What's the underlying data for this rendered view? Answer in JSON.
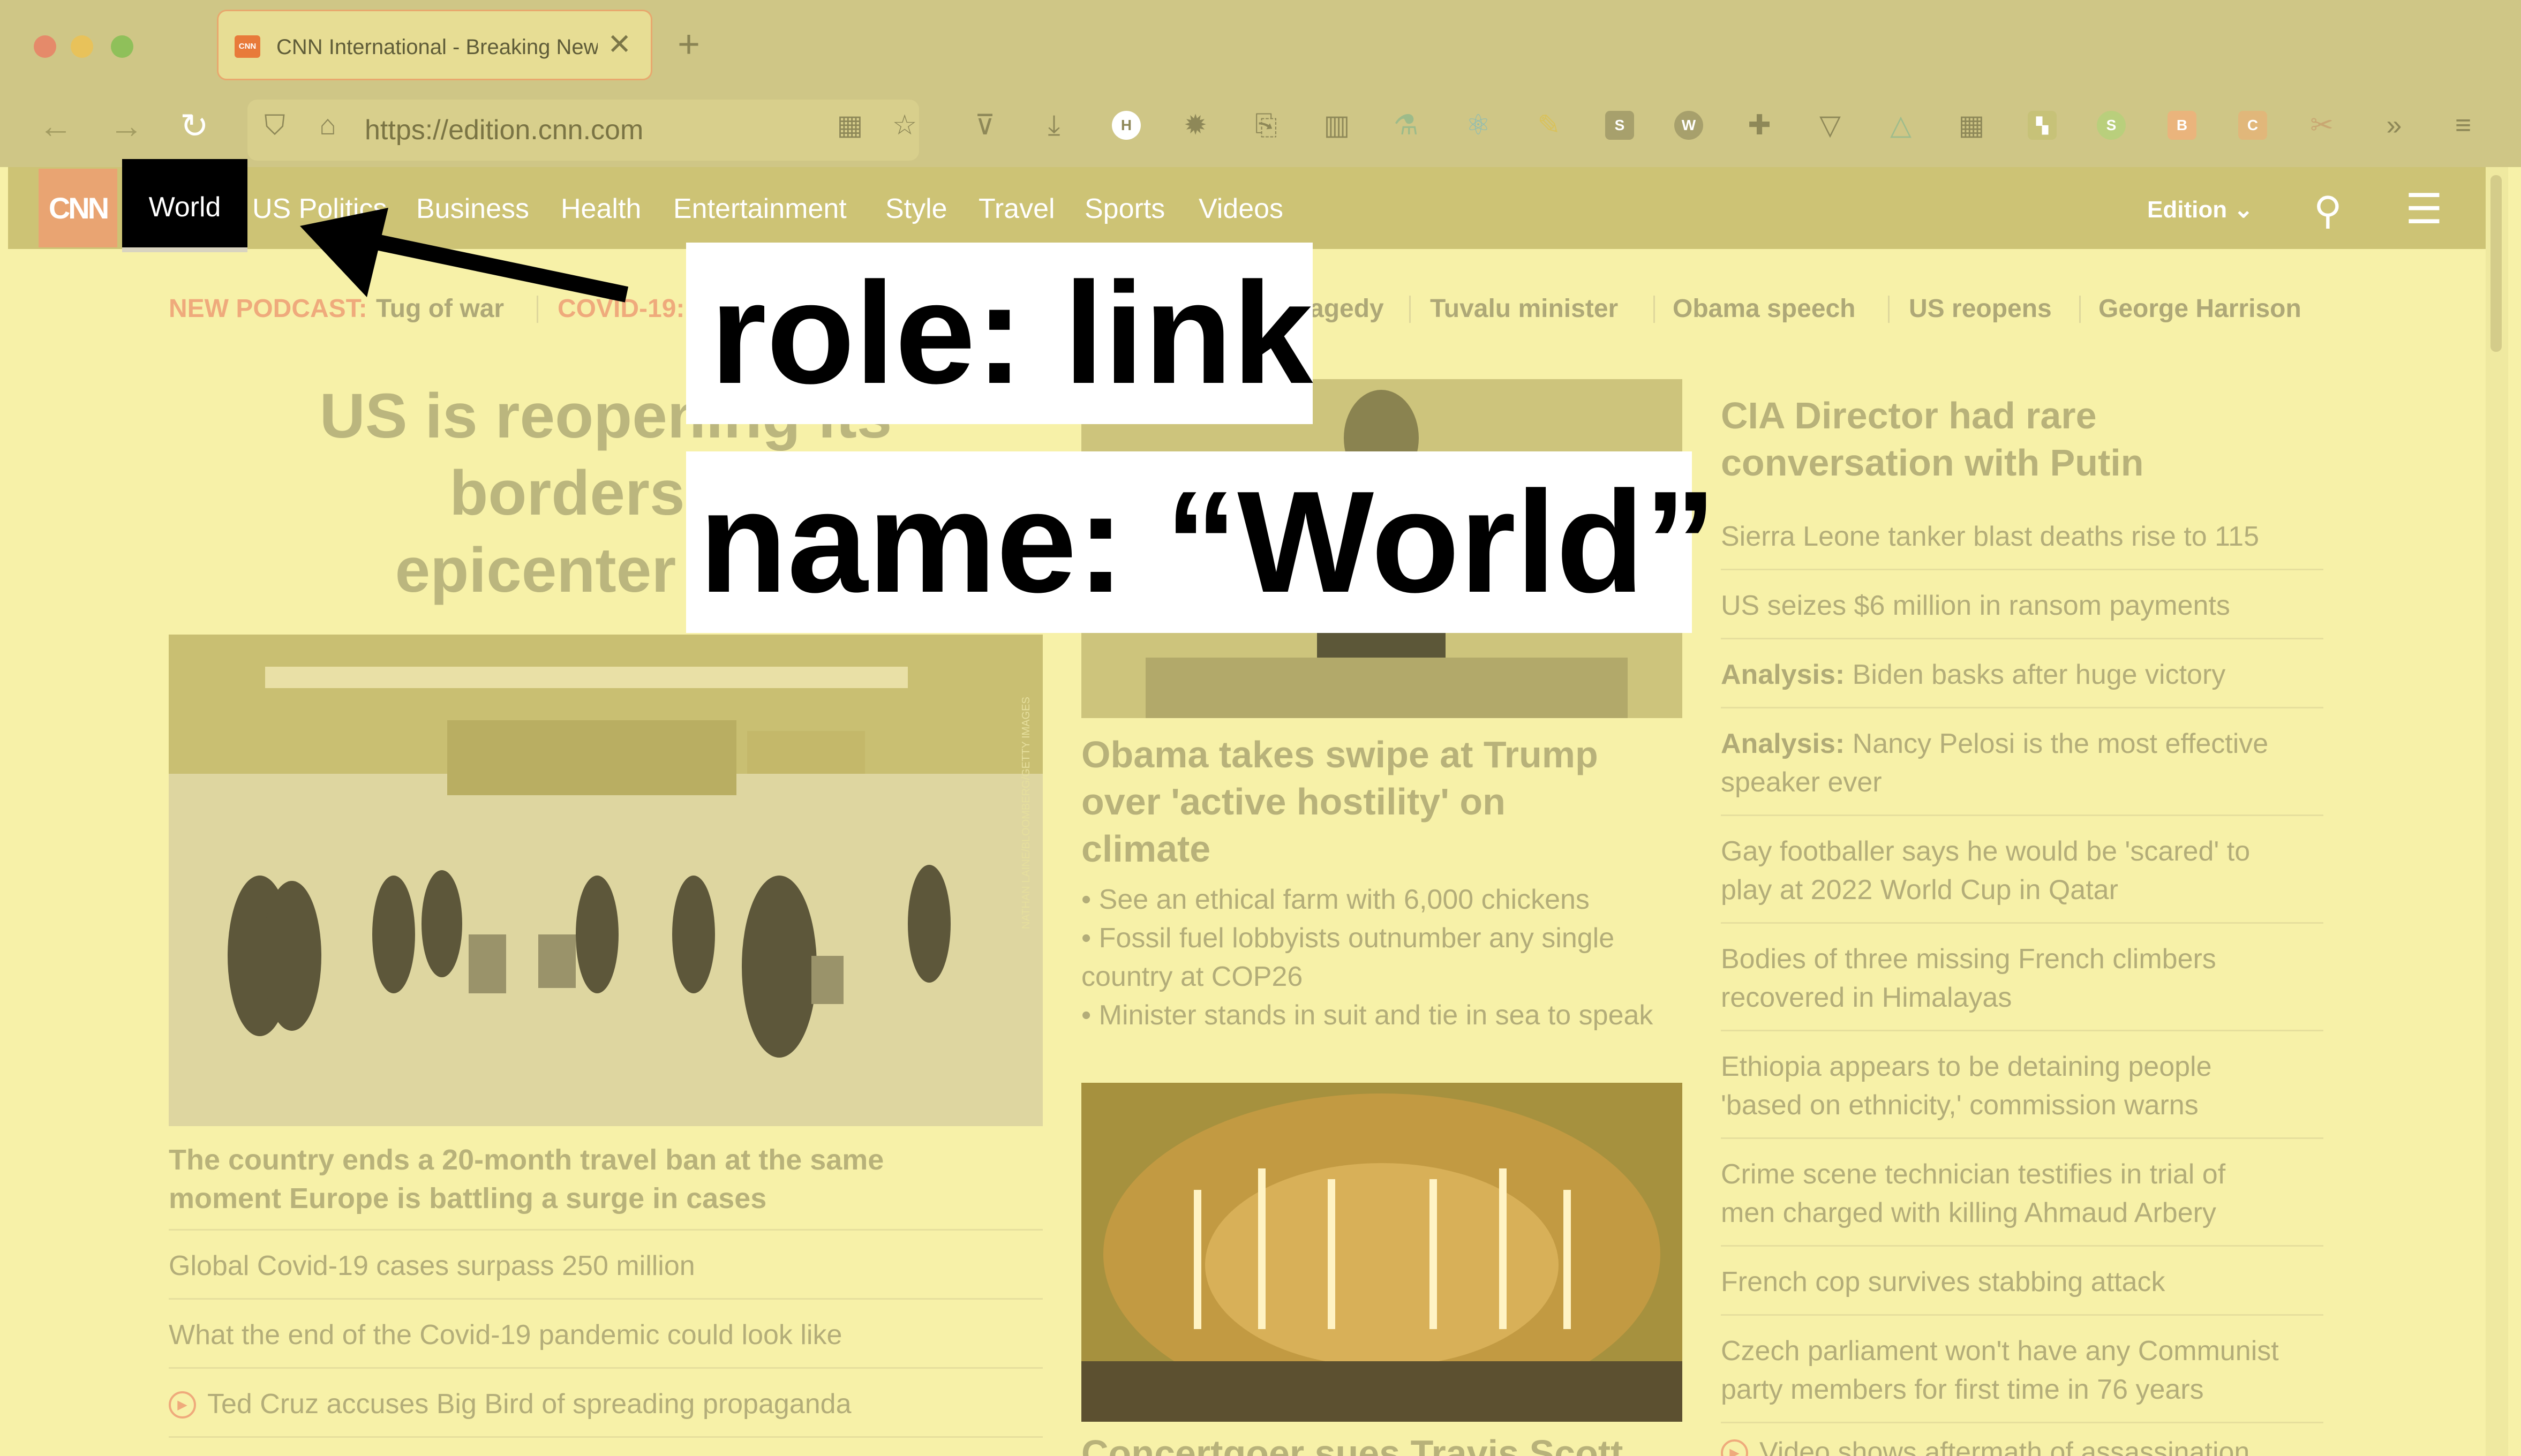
{
  "browser": {
    "tab_title": "CNN International - Breaking News",
    "tab_favicon": "CNN",
    "new_tab": "+",
    "close_tab": "✕",
    "url": "https://edition.cnn.com"
  },
  "nav": {
    "logo": "CNN",
    "active": "World",
    "links": [
      "US Politics",
      "Business",
      "Health",
      "Entertainment",
      "Style",
      "Travel",
      "Sports",
      "Videos"
    ],
    "edition": "Edition"
  },
  "trending": {
    "podcast_label": "NEW PODCAST:",
    "podcast_text": "Tug of war",
    "covid": "COVID-19:",
    "tragedy": "agedy",
    "items": [
      "Tuvalu minister",
      "Obama speech",
      "US reopens",
      "George Harrison"
    ]
  },
  "main": {
    "headline": "US is reopening its borders to epicenter of C",
    "headline_lines": [
      "US is reopening its",
      "borders to",
      "epicenter of C"
    ],
    "caption": "The country ends a 20-month travel ban at the same moment Europe is battling a surge in cases",
    "caption_lines": [
      "The country ends a 20-month travel ban at the same",
      "moment Europe is battling a surge in cases"
    ],
    "links": [
      "Global Covid-19 cases surpass 250 million",
      "What the end of the Covid-19 pandemic could look like",
      "Ted Cruz accuses Big Bird of spreading propaganda"
    ],
    "photo_credit": "NATHAN LAINE/BLOOMBERG/GETTY IMAGES"
  },
  "middle": {
    "headline_lines": [
      "Obama takes swipe at Trump",
      "over 'active hostility' on",
      "climate"
    ],
    "bullets": [
      "See an ethical farm with 6,000 chickens",
      "Fossil fuel lobbyists outnumber any single",
      "country at COP26",
      "Minister stands in suit and tie in sea to speak"
    ],
    "bottom_headline": "Concertgoer sues Travis Scott"
  },
  "right": {
    "headline_lines": [
      "CIA Director had rare",
      "conversation with Putin"
    ],
    "items": [
      {
        "prefix": "",
        "lines": [
          "Sierra Leone tanker blast deaths rise to 115"
        ]
      },
      {
        "prefix": "",
        "lines": [
          "US seizes $6 million in ransom payments"
        ]
      },
      {
        "prefix": "Analysis:",
        "lines": [
          " Biden basks after huge victory"
        ]
      },
      {
        "prefix": "Analysis:",
        "lines": [
          " Nancy Pelosi is the most effective",
          "speaker ever"
        ]
      },
      {
        "prefix": "",
        "lines": [
          "Gay footballer says he would be 'scared' to",
          "play at 2022 World Cup in Qatar"
        ]
      },
      {
        "prefix": "",
        "lines": [
          "Bodies of three missing French climbers",
          "recovered in Himalayas"
        ]
      },
      {
        "prefix": "",
        "lines": [
          "Ethiopia appears to be detaining people",
          "'based on ethnicity,' commission warns"
        ]
      },
      {
        "prefix": "",
        "lines": [
          "Crime scene technician testifies in trial of",
          "men charged with killing Ahmaud Arbery"
        ]
      },
      {
        "prefix": "",
        "lines": [
          "French cop survives stabbing attack"
        ]
      },
      {
        "prefix": "",
        "lines": [
          "Czech parliament won't have any Communist",
          "party members for first time in 76 years"
        ]
      },
      {
        "prefix": "",
        "lines": [
          "Video shows aftermath of assassination"
        ]
      }
    ]
  },
  "annotation": {
    "role": "role: link",
    "name": "name: “World”"
  },
  "colors": {
    "overlay": "#f7f1a8",
    "nav_active": "#000000",
    "cnn_red": "#e9a472"
  }
}
